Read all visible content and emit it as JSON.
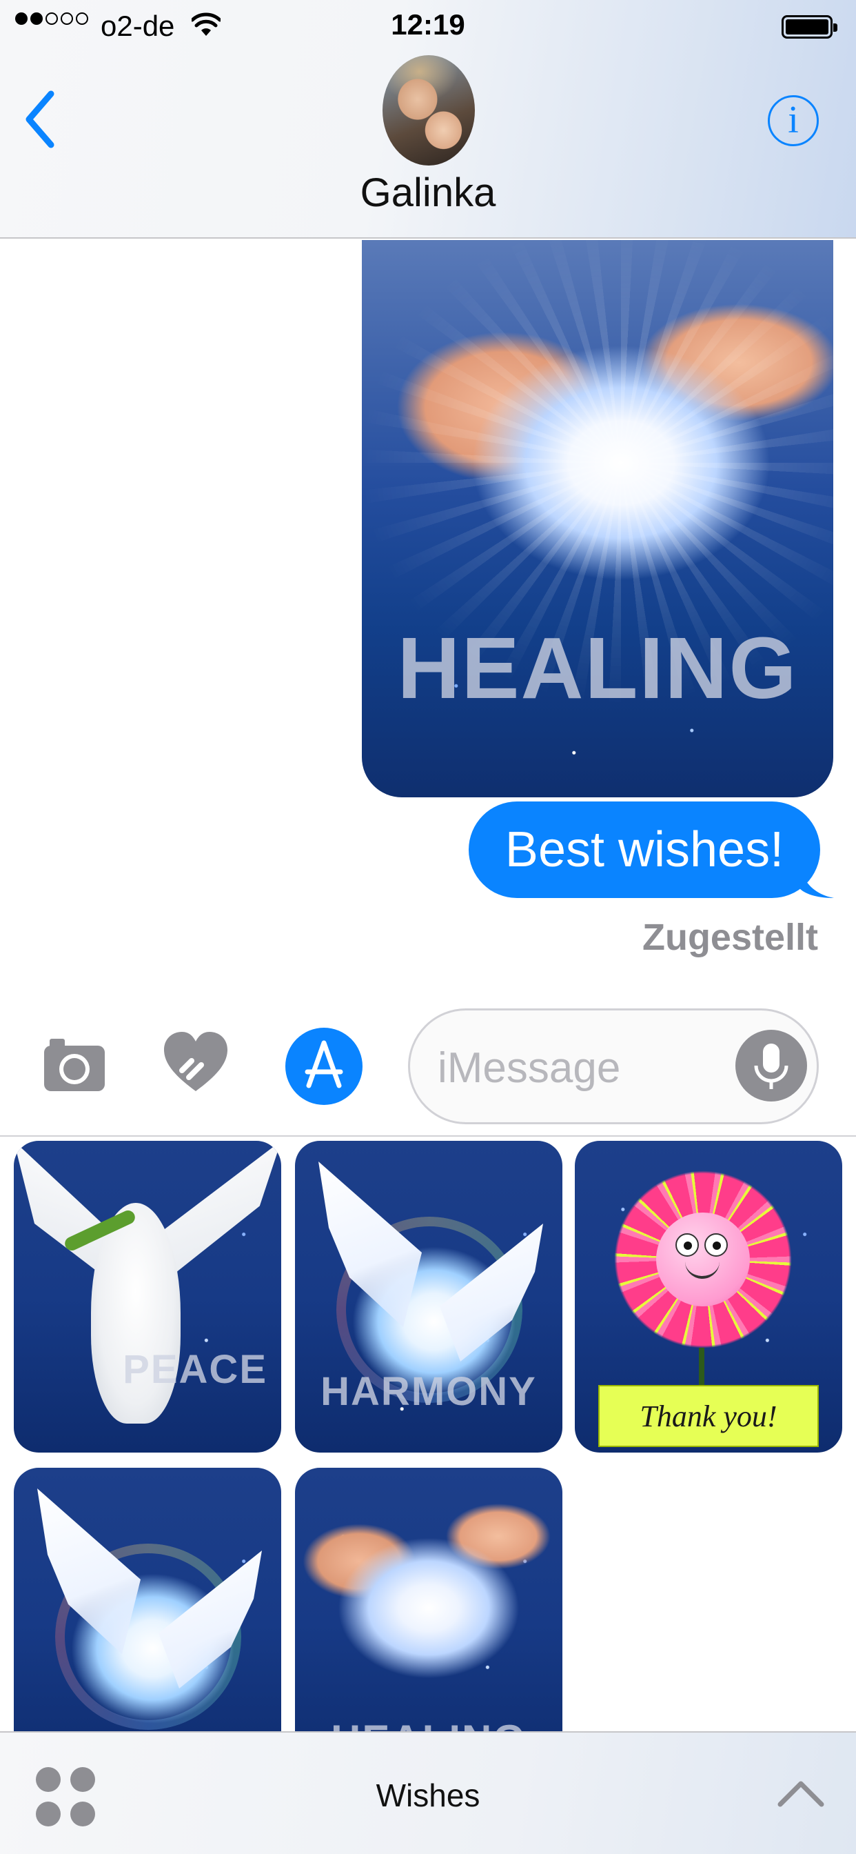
{
  "status_bar": {
    "carrier": "o2-de",
    "time": "12:19",
    "signal_bars_filled": 2,
    "signal_bars_total": 5,
    "wifi_icon": "wifi-icon",
    "battery_icon": "battery-full-icon"
  },
  "nav": {
    "back_icon": "chevron-left-icon",
    "contact_name": "Galinka",
    "info_icon": "info-icon",
    "info_glyph": "i"
  },
  "conversation": {
    "sticker_message": {
      "label": "HEALING"
    },
    "text_message": "Best wishes!",
    "delivery_status": "Zugestellt"
  },
  "input_bar": {
    "camera_icon": "camera-icon",
    "digital_touch_icon": "heart-hand-icon",
    "app_store_icon": "app-store-icon",
    "placeholder": "iMessage",
    "mic_icon": "microphone-icon"
  },
  "sticker_drawer": {
    "stickers": [
      {
        "label": "PEACE"
      },
      {
        "label": "HARMONY"
      },
      {
        "label": "Thank you!"
      },
      {
        "label": ""
      },
      {
        "label": "HEALING"
      }
    ]
  },
  "bottom_bar": {
    "apps_icon": "app-drawer-icon",
    "title": "Wishes",
    "expand_icon": "chevron-up-icon"
  },
  "colors": {
    "accent": "#0a84ff",
    "bubble_text": "#ffffff",
    "secondary": "#8e8e93",
    "thank_you_card": "#e6ff55"
  }
}
